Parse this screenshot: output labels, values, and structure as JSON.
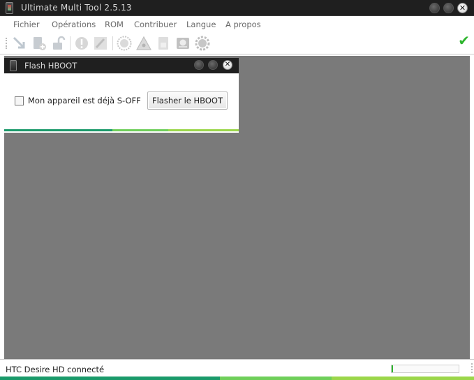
{
  "window": {
    "title": "Ultimate Multi Tool 2.5.13",
    "controls": [
      "minimize-icon",
      "maximize-icon",
      "close-icon"
    ]
  },
  "menu": {
    "items": [
      "Fichier",
      "Opérations",
      "ROM",
      "Contribuer",
      "Langue",
      "A propos"
    ]
  },
  "toolbar": {
    "icons": [
      "flash-arrow-icon",
      "add-device-icon",
      "unlock-icon",
      "warning-icon",
      "brush-icon",
      "stamp-icon",
      "hazard-icon",
      "card-icon",
      "skull-icon",
      "settings-gear-icon"
    ],
    "status_icon": "checkmark-icon"
  },
  "dialog": {
    "title": "Flash HBOOT",
    "checkbox_label": "Mon appareil est déjà S-OFF",
    "checkbox_checked": false,
    "button_label": "Flasher le HBOOT"
  },
  "status": {
    "text": "HTC Desire HD connecté",
    "progress_percent": 2
  },
  "colors": {
    "titlebar": "#1f1f1f",
    "workspace": "#7a7a7a",
    "accent_green": "#2db52d",
    "stripe_teal": "#1a9a6a",
    "stripe_lime": "#9bd64a"
  }
}
